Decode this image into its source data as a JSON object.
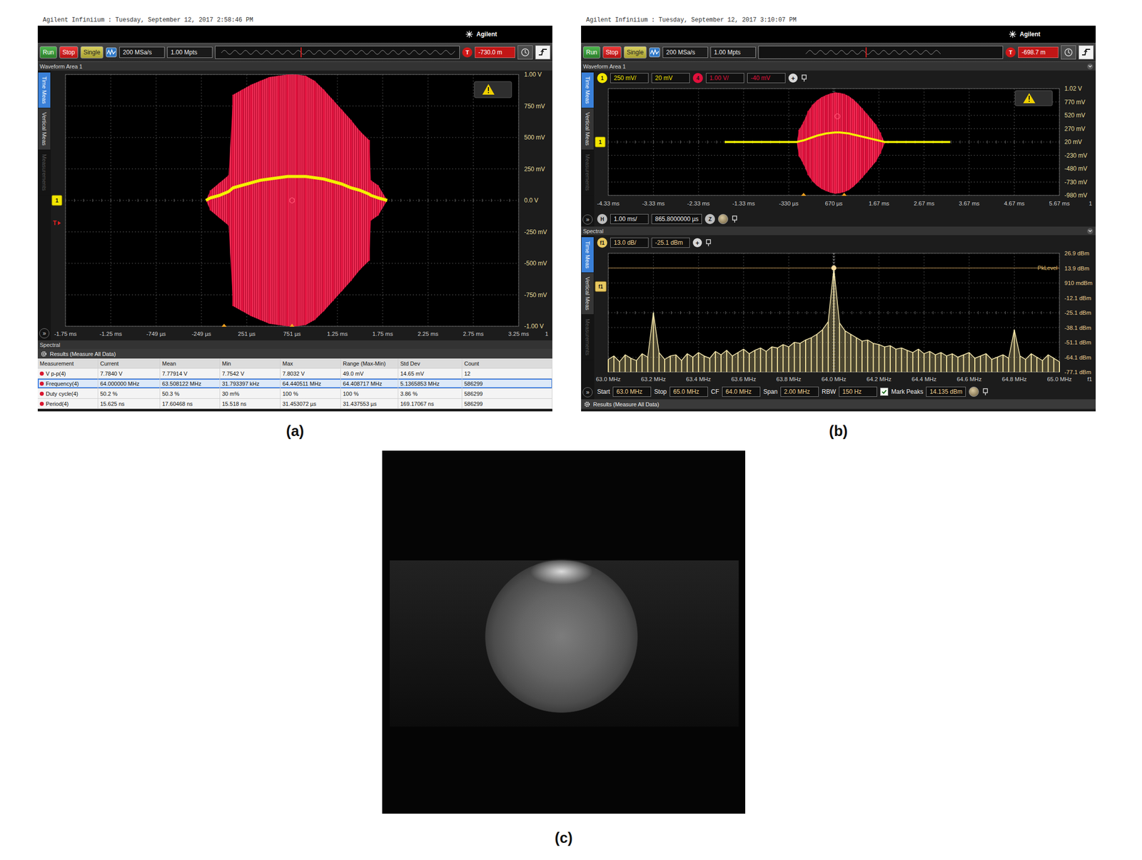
{
  "figure_panels": [
    {
      "kind": "measure",
      "caption": "(a)",
      "header": "Agilent Infiniium : Tuesday, September 12, 2017 2:58:46 PM",
      "logo": "Agilent",
      "toolbar": {
        "run": "Run",
        "stop": "Stop",
        "single": "Single",
        "sample_rate": "200 MSa/s",
        "memory": "1.00 Mpts",
        "trigger_badge": "T",
        "trigger_level": "-730.0 m"
      },
      "area_title": "Waveform Area 1",
      "side_tabs": [
        {
          "label": "Time Meas",
          "selected": true,
          "dimmed": false
        },
        {
          "label": "Vertical Meas",
          "selected": false,
          "dimmed": false
        },
        {
          "label": "Measurements",
          "selected": false,
          "dimmed": true
        }
      ],
      "expand_button": "»",
      "waveform": {
        "channel_tag": "1",
        "trigger_tag": "T",
        "y_ticks": [
          "1.00 V",
          "750 mV",
          "500 mV",
          "250 mV",
          "0.0 V",
          "-250 mV",
          "-500 mV",
          "-750 mV",
          "-1.00 V"
        ],
        "x_ticks": [
          "-1.75 ms",
          "-1.25 ms",
          "-749 µs",
          "-249 µs",
          "251 µs",
          "751 µs",
          "1.25 ms",
          "1.75 ms",
          "2.25 ms",
          "2.75 ms",
          "3.25 ms"
        ],
        "x_end_label": "1",
        "times_ms": [
          -0.2,
          -0.15,
          -0.05,
          0.05,
          0.1,
          0.2,
          0.3,
          0.4,
          0.5,
          0.6,
          0.7,
          0.8,
          0.9,
          1.0,
          1.1,
          1.2,
          1.3,
          1.4,
          1.5,
          1.6,
          1.62,
          1.7,
          1.8
        ],
        "envelope_v": [
          0,
          0.08,
          0.14,
          0.2,
          0.84,
          0.88,
          0.92,
          0.95,
          0.98,
          0.99,
          1.0,
          1.0,
          0.99,
          0.95,
          0.88,
          0.8,
          0.72,
          0.64,
          0.55,
          0.48,
          0.16,
          0.12,
          0
        ],
        "trace_v": [
          0,
          0.02,
          0.04,
          0.07,
          0.1,
          0.12,
          0.14,
          0.16,
          0.17,
          0.18,
          0.19,
          0.19,
          0.19,
          0.18,
          0.17,
          0.15,
          0.13,
          0.1,
          0.08,
          0.05,
          0.04,
          0.02,
          0
        ]
      },
      "spectral_title": "Spectral",
      "results": {
        "title": "Results (Measure All Data)",
        "columns": [
          "Measurement",
          "Current",
          "Mean",
          "Min",
          "Max",
          "Range (Max-Min)",
          "Std Dev",
          "Count"
        ],
        "rows": [
          {
            "cells": [
              "V p-p(4)",
              "7.7840 V",
              "7.77914 V",
              "7.7542 V",
              "7.8032 V",
              "49.0 mV",
              "14.65 mV",
              "12"
            ],
            "selected": false
          },
          {
            "cells": [
              "Frequency(4)",
              "64.000000 MHz",
              "63.508122 MHz",
              "31.793397 kHz",
              "64.440511 MHz",
              "64.408717 MHz",
              "5.1365853 MHz",
              "586299"
            ],
            "selected": true
          },
          {
            "cells": [
              "Duty cycle(4)",
              "50.2 %",
              "50.3 %",
              "30 m%",
              "100 %",
              "100 %",
              "3.86 %",
              "586299"
            ],
            "selected": false
          },
          {
            "cells": [
              "Period(4)",
              "15.625 ns",
              "17.60468 ns",
              "15.518 ns",
              "31.453072 µs",
              "31.437553 µs",
              "169.17067 ns",
              "586299"
            ],
            "selected": false
          }
        ]
      }
    },
    {
      "kind": "spectral",
      "caption": "(b)",
      "header": "Agilent Infiniium : Tuesday, September 12, 2017 3:10:07 PM",
      "logo": "Agilent",
      "toolbar": {
        "run": "Run",
        "stop": "Stop",
        "single": "Single",
        "sample_rate": "200 MSa/s",
        "memory": "1.00 Mpts",
        "trigger_badge": "T",
        "trigger_level": "-698.7 m"
      },
      "area_title": "Waveform Area 1",
      "side_tabs": [
        {
          "label": "Time Meas",
          "selected": true,
          "dimmed": false
        },
        {
          "label": "Vertical Meas",
          "selected": false,
          "dimmed": false
        },
        {
          "label": "Measurements",
          "selected": false,
          "dimmed": true
        }
      ],
      "expand_button": "»",
      "channels": [
        {
          "badge": "1",
          "scale": "250 mV/",
          "offset": "20 mV",
          "color": "#f2e600"
        },
        {
          "badge": "4",
          "scale": "1.00 V/",
          "offset": "-40 mV",
          "color": "#e0103c"
        }
      ],
      "add_button": "+",
      "waveform": {
        "channel_tag": "1",
        "y_ticks": [
          "1.02 V",
          "770 mV",
          "520 mV",
          "270 mV",
          "20 mV",
          "-230 mV",
          "-480 mV",
          "-730 mV",
          "-980 mV"
        ],
        "x_ticks": [
          "-4.33 ms",
          "-3.33 ms",
          "-2.33 ms",
          "-1.33 ms",
          "-330 µs",
          "670 µs",
          "1.67 ms",
          "2.67 ms",
          "3.67 ms",
          "4.67 ms",
          "5.67 ms"
        ],
        "x_end_label": "1",
        "times_ms": [
          -1.75,
          -0.15,
          -0.1,
          0.0,
          0.1,
          0.2,
          0.3,
          0.4,
          0.5,
          0.6,
          0.7,
          0.8,
          0.9,
          1.0,
          1.1,
          1.2,
          1.3,
          1.4,
          1.5,
          1.6,
          1.7,
          1.8,
          3.25
        ],
        "envelope_v": [
          0,
          0,
          0.25,
          0.4,
          0.6,
          0.72,
          0.8,
          0.86,
          0.9,
          0.93,
          0.95,
          0.94,
          0.92,
          0.88,
          0.82,
          0.74,
          0.65,
          0.55,
          0.45,
          0.35,
          0.2,
          0,
          0
        ],
        "trace_v": [
          0.02,
          0.02,
          0.03,
          0.05,
          0.08,
          0.11,
          0.14,
          0.16,
          0.18,
          0.19,
          0.2,
          0.2,
          0.19,
          0.18,
          0.16,
          0.14,
          0.12,
          0.1,
          0.08,
          0.06,
          0.04,
          0.02,
          0.02
        ]
      },
      "horizontal": {
        "badge": "H",
        "scale": "1.00 ms/",
        "position": "865.8000000 µs",
        "zoom_badge": "Z"
      },
      "spectral_title": "Spectral",
      "spectral_side_tabs": [
        {
          "label": "Time Meas",
          "selected": true,
          "dimmed": false
        },
        {
          "label": "Vertical Meas",
          "selected": false,
          "dimmed": false
        },
        {
          "label": "Measurements",
          "selected": false,
          "dimmed": true
        }
      ],
      "spectrum": {
        "badge": "f1",
        "scale": "13.0 dB/",
        "reference": "-25.1 dBm",
        "add_button": "+",
        "channel_tag": "f1",
        "y_ticks": [
          "26.9 dBm",
          "13.9 dBm",
          "910 mdBm",
          "-12.1 dBm",
          "-25.1 dBm",
          "-38.1 dBm",
          "-51.1 dBm",
          "-64.1 dBm",
          "-77.1 dBm"
        ],
        "x_ticks": [
          "63.0 MHz",
          "63.2 MHz",
          "63.4 MHz",
          "63.6 MHz",
          "63.8 MHz",
          "64.0 MHz",
          "64.2 MHz",
          "64.4 MHz",
          "64.6 MHz",
          "64.8 MHz",
          "65.0 MHz"
        ],
        "x_end_label": "f1",
        "peak_label": "PkLevel",
        "levels_dbm": [
          -66,
          -63,
          -68,
          -62,
          -65,
          -67,
          -61,
          -64,
          -25,
          -60,
          -66,
          -63,
          -62,
          -67,
          -61,
          -64,
          -60,
          -63,
          -65,
          -59,
          -62,
          -58,
          -63,
          -60,
          -57,
          -61,
          -58,
          -56,
          -59,
          -55,
          -56,
          -53,
          -55,
          -51,
          -52,
          -49,
          -47,
          -44,
          -40,
          -33,
          14,
          -34,
          -41,
          -44,
          -47,
          -50,
          -49,
          -52,
          -53,
          -55,
          -54,
          -57,
          -56,
          -58,
          -60,
          -57,
          -61,
          -59,
          -62,
          -60,
          -63,
          -61,
          -64,
          -62,
          -60,
          -65,
          -63,
          -61,
          -66,
          -64,
          -62,
          -65,
          -40,
          -63,
          -66,
          -61,
          -64,
          -67,
          -62,
          -65,
          -68
        ]
      },
      "controls": [
        {
          "label": "Start",
          "value": "63.0 MHz"
        },
        {
          "label": "Stop",
          "value": "65.0 MHz"
        },
        {
          "label": "CF",
          "value": "64.0 MHz"
        },
        {
          "label": "Span",
          "value": "2.00 MHz"
        },
        {
          "label": "RBW",
          "value": "150 Hz"
        }
      ],
      "mark_peaks": {
        "label": "Mark Peaks",
        "checked": true,
        "value": "14.135 dBm"
      },
      "results_title": "Results (Measure All Data)"
    }
  ],
  "mri": {
    "caption": "(c)"
  }
}
